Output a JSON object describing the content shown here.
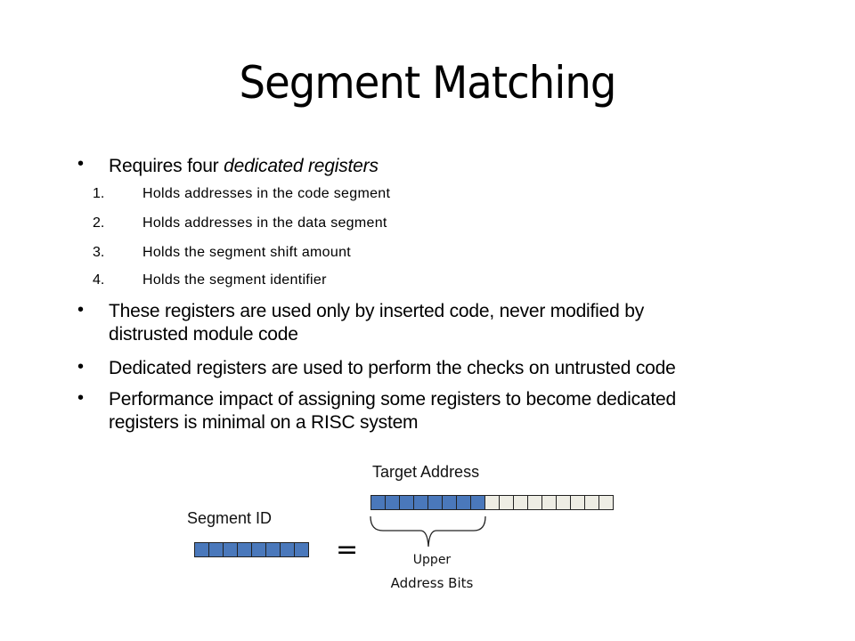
{
  "slide": {
    "title": "Segment Matching",
    "bullets": [
      {
        "text_plain": "Requires four ",
        "text_italic": "dedicated registers",
        "subitems": [
          {
            "num": "1.",
            "text": "Holds addresses in the code segment"
          },
          {
            "num": "2.",
            "text": "Holds addresses in the data segment"
          },
          {
            "num": "3.",
            "text": "Holds the segment shift amount"
          },
          {
            "num": "4.",
            "text": "Holds the segment identifier"
          }
        ]
      },
      {
        "line1": "These registers are used only by inserted code, never modified by",
        "line2": "distrusted module code"
      },
      {
        "line1": "Dedicated registers are used to perform the checks on untrusted code"
      },
      {
        "line1": "Performance impact of assigning some registers to become dedicated",
        "line2": "registers is minimal on a RISC system"
      }
    ],
    "bullet_glyph": "•"
  },
  "diagram": {
    "target_label": "Target Address",
    "segment_label": "Segment ID",
    "equals": "=",
    "brace_label_line1": "Upper",
    "brace_label_line2": "Address Bits",
    "target_bits": {
      "upper": 8,
      "lower": 9
    },
    "segment_bits": 8,
    "colors": {
      "upper_bit": "#4a78bb",
      "lower_bit": "#eeede4",
      "border": "#222222"
    }
  }
}
